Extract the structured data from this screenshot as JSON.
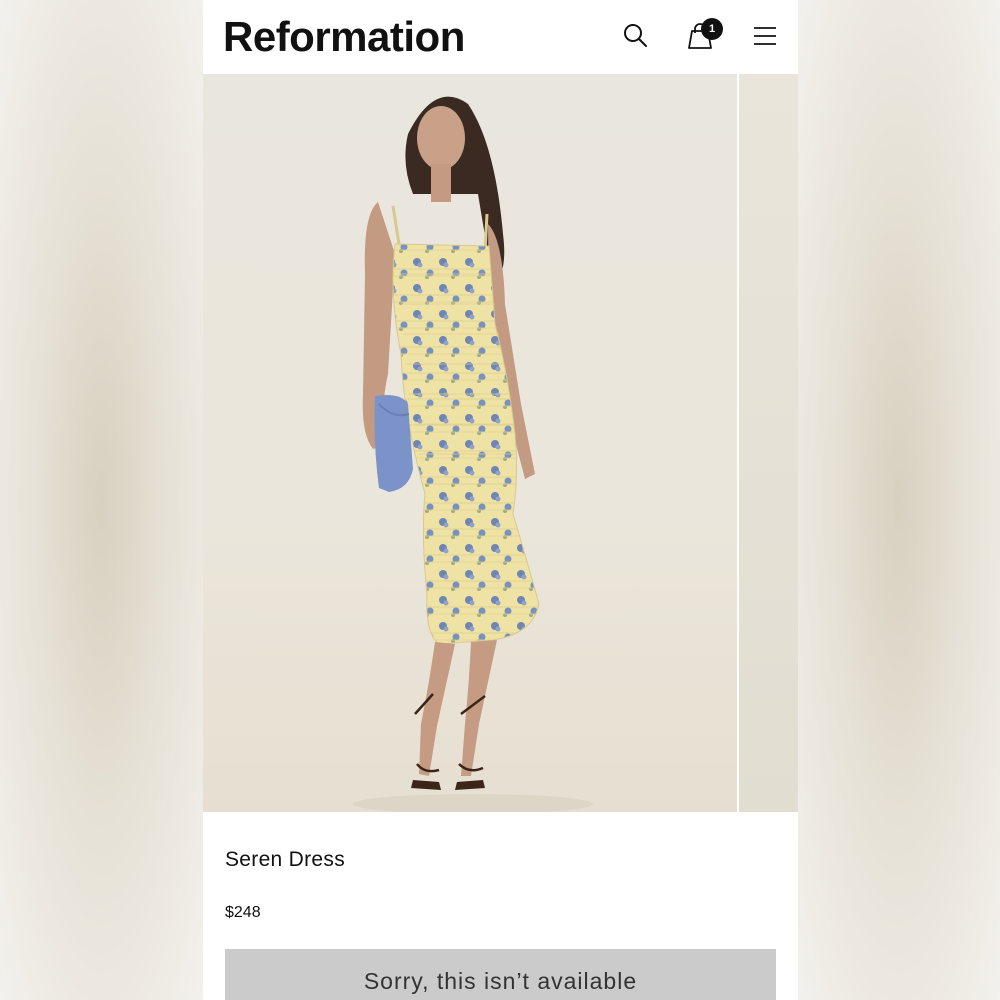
{
  "header": {
    "logo": "Reformation",
    "cart_count": "1",
    "icons": [
      "search-icon",
      "shopping-bag-icon",
      "hamburger-menu-icon"
    ]
  },
  "product": {
    "name": "Seren Dress",
    "price": "$248",
    "availability_button": "Sorry, this isn’t available"
  },
  "colors": {
    "dress_yellow": "#efe2a5",
    "floral_blue": "#6f86b4",
    "clutch_blue": "#7b93c9",
    "button_gray": "#cbcbcb",
    "photo_bg": "#ece8de"
  }
}
